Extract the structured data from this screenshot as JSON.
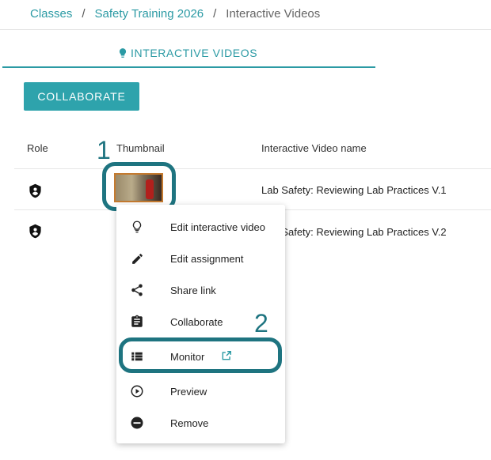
{
  "breadcrumb": {
    "items": [
      "Classes",
      "Safety Training 2026"
    ],
    "separator": "/",
    "current": "Interactive Videos"
  },
  "tab": {
    "label": "INTERACTIVE VIDEOS",
    "icon": "lightbulb-icon"
  },
  "toolbar": {
    "collaborate_label": "COLLABORATE"
  },
  "table": {
    "headers": {
      "role": "Role",
      "thumbnail": "Thumbnail",
      "name": "Interactive Video name"
    },
    "rows": [
      {
        "role_icon": "shield-person-icon",
        "name": "Lab Safety: Reviewing Lab Practices V.1"
      },
      {
        "role_icon": "shield-person-icon",
        "name": "Lab Safety: Reviewing Lab Practices V.2"
      }
    ]
  },
  "menu": {
    "items": [
      {
        "label": "Edit interactive video",
        "icon": "lightbulb-icon"
      },
      {
        "label": "Edit assignment",
        "icon": "pencil-icon"
      },
      {
        "label": "Share link",
        "icon": "share-icon"
      },
      {
        "label": "Collaborate",
        "icon": "clipboard-icon"
      },
      {
        "label": "Monitor",
        "icon": "list-icon"
      },
      {
        "label": "Preview",
        "icon": "play-circle-icon"
      },
      {
        "label": "Remove",
        "icon": "minus-circle-icon"
      }
    ]
  },
  "callouts": {
    "first": "1",
    "second": "2"
  },
  "colors": {
    "accent": "#2b9aa4",
    "highlight": "#1e7480"
  }
}
